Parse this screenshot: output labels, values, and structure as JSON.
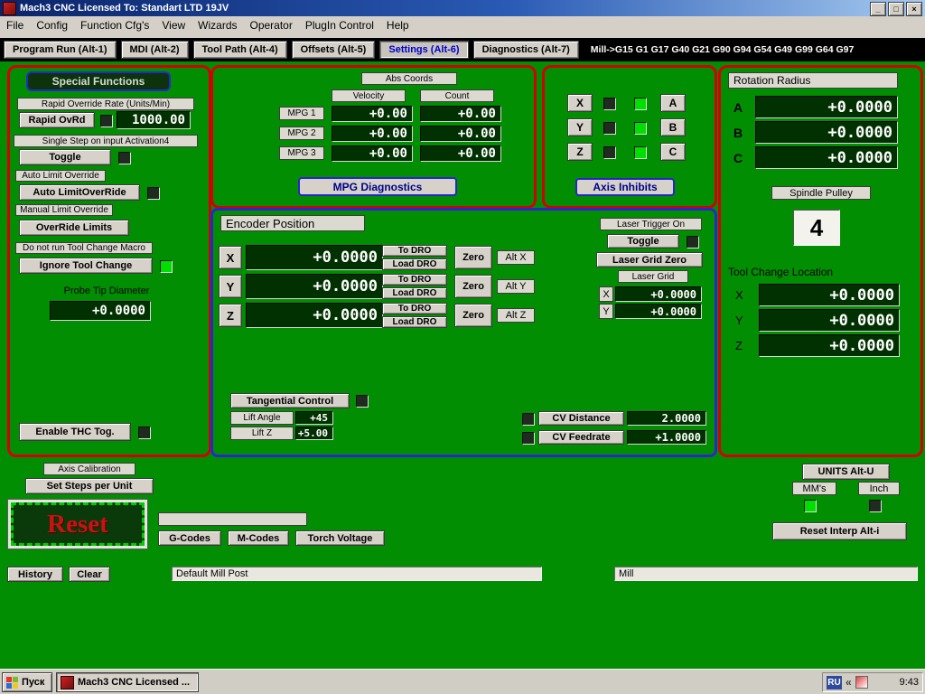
{
  "window": {
    "title": "Mach3 CNC  Licensed To: Standart LTD 19JV",
    "controls": {
      "minimize": "_",
      "restore": "□",
      "close": "×"
    }
  },
  "menu": {
    "items": [
      "File",
      "Config",
      "Function Cfg's",
      "View",
      "Wizards",
      "Operator",
      "PlugIn Control",
      "Help"
    ]
  },
  "tabs": {
    "items": [
      "Program Run (Alt-1)",
      "MDI (Alt-2)",
      "Tool Path (Alt-4)",
      "Offsets (Alt-5)",
      "Settings (Alt-6)",
      "Diagnostics (Alt-7)"
    ],
    "active": "Settings (Alt-6)",
    "gcode_status": "Mill->G15 G1 G17 G40 G21 G90 G94 G54 G49 G99 G64 G97"
  },
  "special_functions": {
    "title": "Special Functions",
    "rapid_override_label": "Rapid Override Rate (Units/Min)",
    "rapid_ovrd_button": "Rapid OvRd",
    "rapid_ovrd_value": "1000.00",
    "single_step_label": "Single Step on input Activation4",
    "toggle_button": "Toggle",
    "auto_limit_label": "Auto Limit Override",
    "auto_limit_button": "Auto LimitOverRide",
    "manual_limit_label": "Manual Limit Override",
    "override_limits_button": "OverRide Limits",
    "tool_change_label": "Do not run Tool Change Macro",
    "ignore_tool_change_button": "Ignore Tool Change",
    "probe_tip_label": "Probe Tip Diameter",
    "probe_tip_value": "+0.0000",
    "enable_thc_button": "Enable THC Tog."
  },
  "mpg": {
    "abs_coords_label": "Abs Coords",
    "velocity_header": "Velocity",
    "count_header": "Count",
    "rows": [
      {
        "label": "MPG 1",
        "velocity": "+0.00",
        "count": "+0.00"
      },
      {
        "label": "MPG 2",
        "velocity": "+0.00",
        "count": "+0.00"
      },
      {
        "label": "MPG 3",
        "velocity": "+0.00",
        "count": "+0.00"
      }
    ],
    "diagnostics_button": "MPG Diagnostics"
  },
  "axis_inhibits": {
    "rows": [
      {
        "left_axis": "X",
        "right_axis": "A"
      },
      {
        "left_axis": "Y",
        "right_axis": "B"
      },
      {
        "left_axis": "Z",
        "right_axis": "C"
      }
    ],
    "button": "Axis Inhibits"
  },
  "rotation_radius": {
    "title": "Rotation Radius",
    "rows": [
      {
        "axis": "A",
        "value": "+0.0000"
      },
      {
        "axis": "B",
        "value": "+0.0000"
      },
      {
        "axis": "C",
        "value": "+0.0000"
      }
    ],
    "spindle_pulley_label": "Spindle Pulley",
    "spindle_pulley_value": "4",
    "tool_change_label": "Tool Change Location",
    "tool_change_rows": [
      {
        "axis": "X",
        "value": "+0.0000"
      },
      {
        "axis": "Y",
        "value": "+0.0000"
      },
      {
        "axis": "Z",
        "value": "+0.0000"
      }
    ]
  },
  "encoder": {
    "title": "Encoder Position",
    "rows": [
      {
        "axis": "X",
        "value": "+0.0000",
        "to_dro": "To DRO",
        "load_dro": "Load DRO",
        "zero": "Zero",
        "alt": "Alt X"
      },
      {
        "axis": "Y",
        "value": "+0.0000",
        "to_dro": "To DRO",
        "load_dro": "Load DRO",
        "zero": "Zero",
        "alt": "Alt Y"
      },
      {
        "axis": "Z",
        "value": "+0.0000",
        "to_dro": "To DRO",
        "load_dro": "Load DRO",
        "zero": "Zero",
        "alt": "Alt Z"
      }
    ],
    "laser": {
      "trigger_label": "Laser Trigger On",
      "toggle_button": "Toggle",
      "grid_zero_button": "Laser Grid Zero",
      "grid_label": "Laser Grid",
      "x_label": "X",
      "x_value": "+0.0000",
      "y_label": "Y",
      "y_value": "+0.0000"
    },
    "tangential": {
      "button": "Tangential Control",
      "lift_angle_label": "Lift Angle",
      "lift_angle_value": "+45",
      "lift_z_label": "Lift Z",
      "lift_z_value": "+5.00"
    },
    "cv": {
      "distance_button": "CV Distance",
      "distance_value": "2.0000",
      "feedrate_button": "CV Feedrate",
      "feedrate_value": "+1.0000"
    }
  },
  "bottom": {
    "axis_calibration_label": "Axis Calibration",
    "set_steps_button": "Set Steps per Unit",
    "reset_button": "Reset",
    "profile_field": "",
    "gcodes_button": "G-Codes",
    "mcodes_button": "M-Codes",
    "torch_voltage_button": "Torch Voltage",
    "units_button": "UNITS Alt-U",
    "mm_label": "MM's",
    "inch_label": "Inch",
    "reset_interp_button": "Reset Interp Alt-i",
    "history_button": "History",
    "clear_button": "Clear",
    "post_field": "Default Mill Post",
    "mill_field": "Mill"
  },
  "taskbar": {
    "start_button": "Пуск",
    "task_item": "Mach3 CNC  Licensed ...",
    "language_indicator": "RU",
    "time": "9:43"
  },
  "colors": {
    "screen_green": "#028E02",
    "dro_background": "#013101",
    "panel_border_red": "#D40000",
    "panel_border_blue": "#2828C8",
    "led_on": "#00E000",
    "led_off": "#1F2B1F",
    "titlebar_blue": "#0A246A"
  }
}
